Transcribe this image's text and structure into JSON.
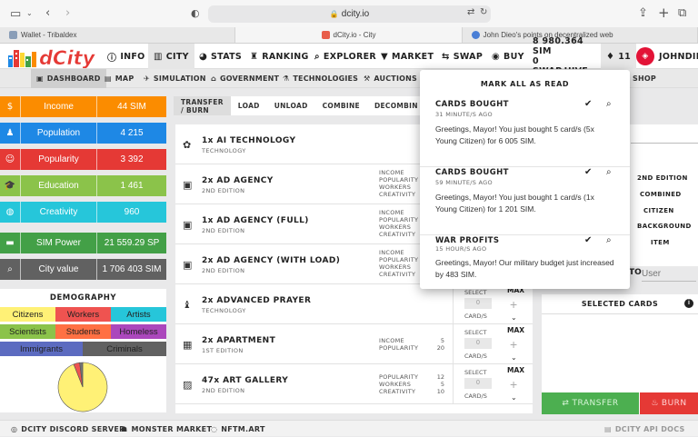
{
  "browser": {
    "url": "dcity.io",
    "tabs": [
      {
        "title": "Wallet - Tribaldex"
      },
      {
        "title": "dCity.io - City"
      },
      {
        "title": "John Dieo's points on decentralized web"
      }
    ]
  },
  "nav": {
    "logo": "dCity",
    "items": [
      "INFO",
      "CITY",
      "STATS",
      "RANKING",
      "EXPLORER",
      "MARKET",
      "SWAP",
      "BUY"
    ],
    "balance_sim": "8 980.364 SIM",
    "balance_swap": "0 SWAP.HIVE",
    "notif_count": "11",
    "user": "JOHNDIE"
  },
  "subnav": [
    "DASHBOARD",
    "MAP",
    "SIMULATION",
    "GOVERNMENT",
    "TECHNOLOGIES",
    "AUCTIONS",
    "SHOP"
  ],
  "stats": [
    {
      "label": "Income",
      "value": "44 SIM",
      "color": "#fb8c00",
      "icon": "dollar-icon"
    },
    {
      "label": "Population",
      "value": "4 215",
      "color": "#1e88e5",
      "icon": "person-icon"
    },
    {
      "label": "Popularity",
      "value": "3 392",
      "color": "#e53935",
      "icon": "smile-icon"
    },
    {
      "label": "Education",
      "value": "1 461",
      "color": "#8bc34a",
      "icon": "graduation-cap-icon"
    },
    {
      "label": "Creativity",
      "value": "960",
      "color": "#26c6da",
      "icon": "palette-icon"
    },
    {
      "label": "SIM Power",
      "value": "21 559.29 SP",
      "color": "#43a047",
      "icon": "wallet-icon"
    },
    {
      "label": "City value",
      "value": "1 706 403 SIM",
      "color": "#616161",
      "icon": "search-icon"
    }
  ],
  "demography": {
    "title": "DEMOGRAPHY",
    "groups": [
      {
        "label": "Citizens",
        "color": "#fff176"
      },
      {
        "label": "Workers",
        "color": "#ef5350"
      },
      {
        "label": "Artists",
        "color": "#26c6da"
      },
      {
        "label": "Scientists",
        "color": "#8bc34a"
      },
      {
        "label": "Students",
        "color": "#ff7043"
      },
      {
        "label": "Homeless",
        "color": "#ab47bc"
      },
      {
        "label": "Immigrants",
        "color": "#5c6bc0"
      },
      {
        "label": "Criminals",
        "color": "#616161"
      }
    ],
    "pie": [
      {
        "label": "Citizens",
        "value": 94,
        "color": "#fff176"
      },
      {
        "label": "Workers",
        "value": 4,
        "color": "#ef5350"
      },
      {
        "label": "Criminals",
        "value": 2,
        "color": "#757575"
      }
    ]
  },
  "actions": [
    "TRANSFER / BURN",
    "LOAD",
    "UNLOAD",
    "COMBINE",
    "DECOMBIN"
  ],
  "cards": [
    {
      "name": "1x AI TECHNOLOGY",
      "sub": "TECHNOLOGY",
      "icon": "brain-icon",
      "stats": [],
      "values": [],
      "select": false
    },
    {
      "name": "2x AD AGENCY",
      "sub": "2ND EDITION",
      "icon": "ad-icon",
      "stats": [
        "INCOME",
        "POPULARITY",
        "WORKERS",
        "CREATIVITY"
      ],
      "values": [],
      "select": false
    },
    {
      "name": "1x AD AGENCY (FULL)",
      "sub": "2ND EDITION",
      "icon": "ad-icon",
      "stats": [
        "INCOME",
        "POPULARITY",
        "WORKERS",
        "CREATIVITY"
      ],
      "values": [],
      "select": false
    },
    {
      "name": "2x AD AGENCY (WITH LOAD)",
      "sub": "2ND EDITION",
      "icon": "ad-icon",
      "stats": [
        "INCOME",
        "POPULARITY",
        "WORKERS",
        "CREATIVITY"
      ],
      "values": [],
      "select": false
    },
    {
      "name": "2x ADVANCED PRAYER",
      "sub": "TECHNOLOGY",
      "icon": "prayer-icon",
      "stats": [],
      "values": [],
      "select": true
    },
    {
      "name": "2x APARTMENT",
      "sub": "1ST EDITION",
      "icon": "building-icon",
      "stats": [
        "INCOME",
        "POPULARITY"
      ],
      "values": [
        "5",
        "20"
      ],
      "select": true
    },
    {
      "name": "47x ART GALLERY",
      "sub": "2ND EDITION",
      "icon": "image-icon",
      "stats": [
        "POPULARITY",
        "WORKERS",
        "CREATIVITY"
      ],
      "values": [
        "12",
        "5",
        "10"
      ],
      "select": true
    }
  ],
  "card_controls": {
    "select": "SELECT",
    "qty": "0",
    "unit": "CARD/S",
    "max": "MAX"
  },
  "right_panel": {
    "items": [
      "2ND EDITION",
      "COMBINED",
      "CITIZEN",
      "BACKGROUND",
      "ITEM"
    ],
    "to_label": "TO",
    "to_placeholder": "User",
    "selected_title": "SELECTED CARDS",
    "transfer": "TRANSFER",
    "burn": "BURN"
  },
  "notifications": {
    "mark_all": "MARK ALL AS READ",
    "items": [
      {
        "title": "CARDS BOUGHT",
        "age": "31 MINUTE/S AGO",
        "message": "Greetings, Mayor! You just bought 5 card/s (5x Young Citizen) for 6 005 SIM."
      },
      {
        "title": "CARDS BOUGHT",
        "age": "59 MINUTE/S AGO",
        "message": "Greetings, Mayor! You just bought 1 card/s (1x Young Citizen) for 1 201 SIM."
      },
      {
        "title": "WAR PROFITS",
        "age": "15 HOUR/S AGO",
        "message": "Greetings, Mayor! Our military budget just increased by 483 SIM."
      }
    ]
  },
  "footer": [
    "DCITY DISCORD SERVER",
    "MONSTER MARKET",
    "NFTM.ART",
    "DCITY API DOCS"
  ]
}
